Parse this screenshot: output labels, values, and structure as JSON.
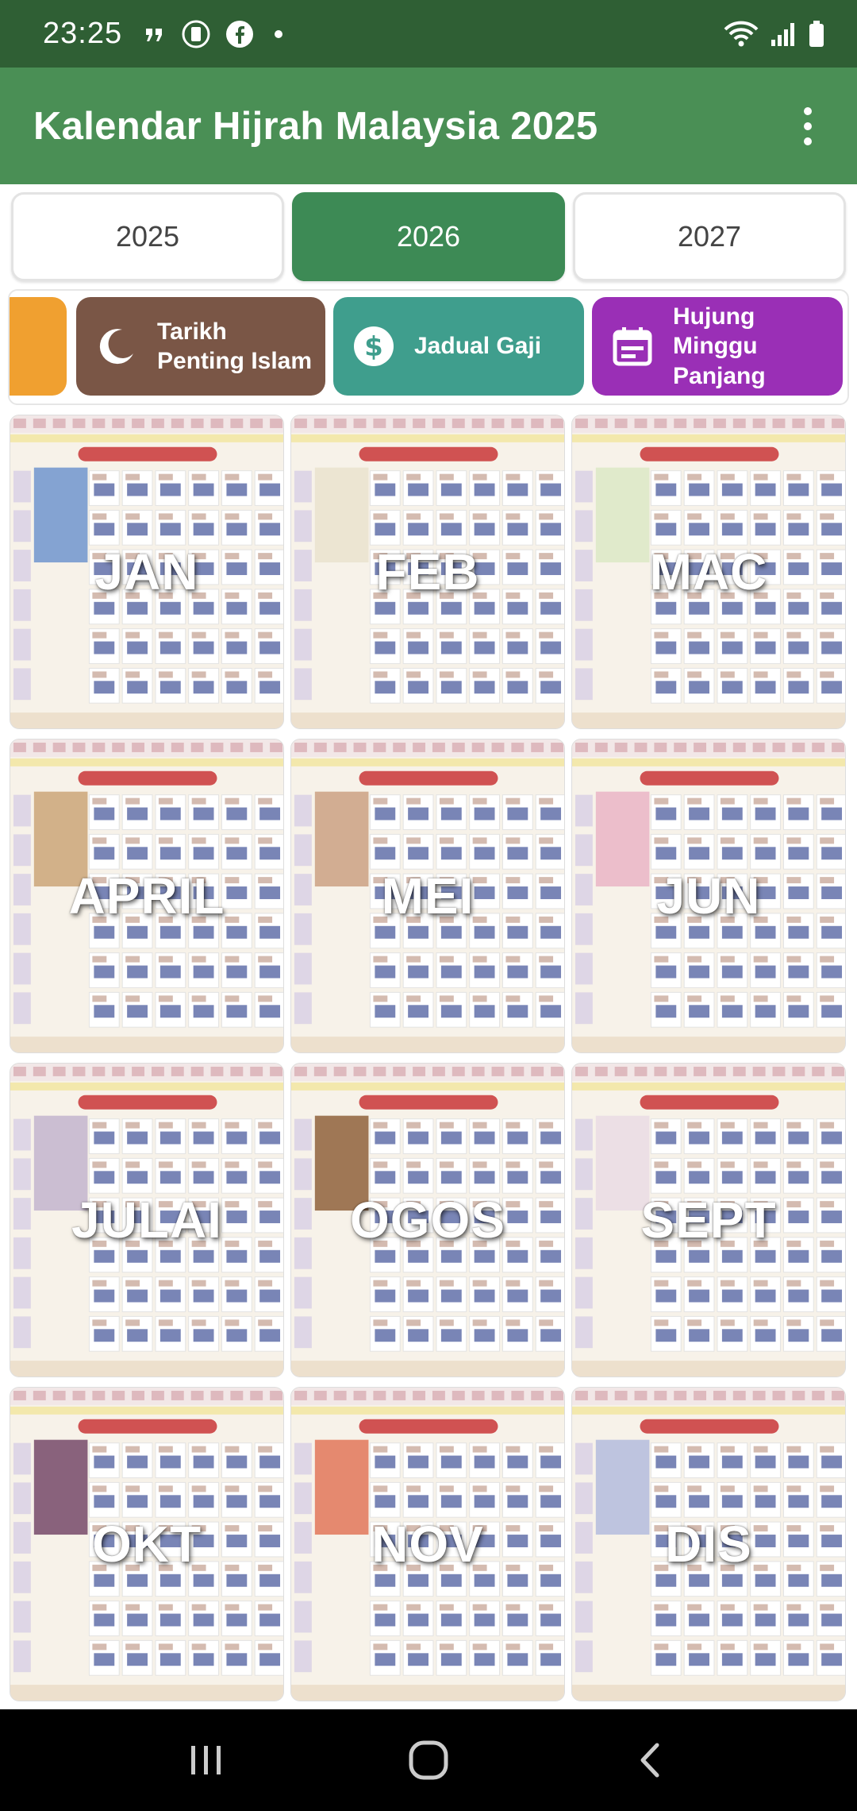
{
  "status_bar": {
    "time": "23:25",
    "icons_left": [
      "quote-icon",
      "app-badge-icon",
      "facebook-icon",
      "dot-icon"
    ],
    "icons_right": [
      "wifi-icon",
      "signal-icon",
      "battery-icon"
    ]
  },
  "app_bar": {
    "title": "Kalendar Hijrah Malaysia 2025",
    "menu_icon": "more-vert-icon"
  },
  "year_tabs": [
    {
      "label": "2025",
      "selected": false
    },
    {
      "label": "2026",
      "selected": true
    },
    {
      "label": "2027",
      "selected": false
    }
  ],
  "shortcuts": [
    {
      "label": "",
      "color": "#f0a030"
    },
    {
      "label": "Tarikh Penting Islam",
      "icon": "crescent-moon-icon",
      "color": "#7a5646"
    },
    {
      "label": "Jadual Gaji",
      "icon": "dollar-icon",
      "color": "#3f9e8d"
    },
    {
      "label": "Hujung Minggu Panjang",
      "icon": "calendar-icon",
      "color": "#9a2fb6"
    }
  ],
  "months": [
    {
      "label": "JAN"
    },
    {
      "label": "FEB"
    },
    {
      "label": "MAC"
    },
    {
      "label": "APRIL"
    },
    {
      "label": "MEI"
    },
    {
      "label": "JUN"
    },
    {
      "label": "JULAI"
    },
    {
      "label": "OGOS"
    },
    {
      "label": "SEPT"
    },
    {
      "label": "OKT"
    },
    {
      "label": "NOV"
    },
    {
      "label": "DIS"
    }
  ],
  "colors": {
    "status_bar": "#2f5f34",
    "app_bar": "#4a8f55",
    "selected_tab": "#3d8a55"
  },
  "nav_bar": {
    "icons": [
      "recent-apps-icon",
      "home-icon",
      "back-icon"
    ]
  }
}
